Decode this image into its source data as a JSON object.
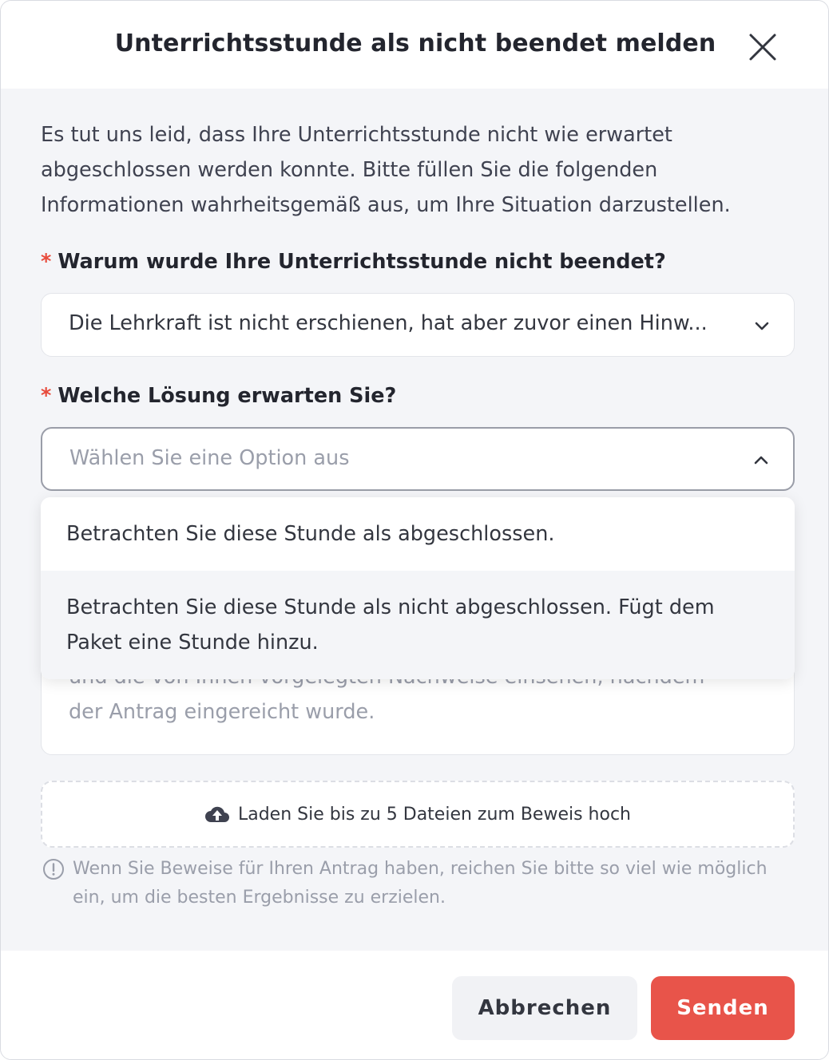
{
  "dialog": {
    "title": "Unterrichtsstunde als nicht beendet melden",
    "intro": "Es tut uns leid, dass Ihre Unterrichtsstunde nicht wie erwartet abgeschlossen werden konnte. Bitte füllen Sie die folgenden Informationen wahrheitsgemäß aus, um Ihre Situation darzustellen."
  },
  "reason": {
    "required_mark": "*",
    "label": "Warum wurde Ihre Unterrichtsstunde nicht beendet?",
    "value": "Die Lehrkraft ist nicht erschienen, hat aber zuvor einen Hinw..."
  },
  "solution": {
    "required_mark": "*",
    "label": "Welche Lösung erwarten Sie?",
    "placeholder": "Wählen Sie eine Option aus",
    "options": [
      "Betrachten Sie diese Stunde als abgeschlossen.",
      "Betrachten Sie diese Stunde als nicht abgeschlossen. Fügt dem Paket eine Stunde hinzu."
    ]
  },
  "details": {
    "placeholder_hidden": "und die von Ihnen vorgelegten Nachweise einsehen, nachdem",
    "placeholder_visible": "der Antrag eingereicht wurde."
  },
  "upload": {
    "label": "Laden Sie bis zu 5 Dateien zum Beweis hoch",
    "icon": "cloud-upload-icon"
  },
  "hint": {
    "icon": "info-icon",
    "text": "Wenn Sie Beweise für Ihren Antrag haben, reichen Sie bitte so viel wie möglich ein, um die besten Ergebnisse zu erzielen."
  },
  "footer": {
    "cancel_label": "Abbrechen",
    "send_label": "Senden"
  },
  "colors": {
    "accent": "#e8544a",
    "required": "#e84b3c",
    "background": "#f4f5f8"
  }
}
